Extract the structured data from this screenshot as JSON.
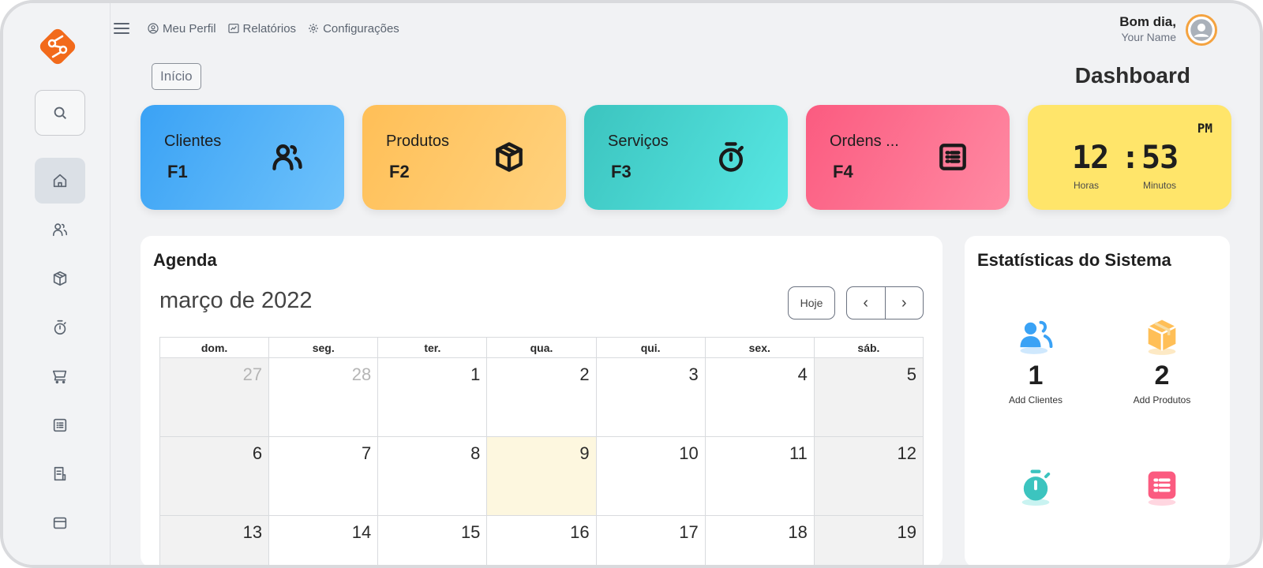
{
  "topbar": {
    "links": [
      {
        "label": "Meu Perfil",
        "icon": "user-circle-icon"
      },
      {
        "label": "Relatórios",
        "icon": "chart-icon"
      },
      {
        "label": "Configurações",
        "icon": "gear-icon"
      }
    ],
    "greeting": "Bom dia,",
    "user_name": "Your Name"
  },
  "breadcrumb": "Início",
  "page_title": "Dashboard",
  "sidebar": {
    "items": [
      "search-icon",
      "home-icon",
      "users-icon",
      "box-icon",
      "stopwatch-icon",
      "cart-icon",
      "list-icon",
      "receipt-icon",
      "card-icon"
    ]
  },
  "cards": [
    {
      "label": "Clientes",
      "key": "F1",
      "icon": "users-icon",
      "color": "#3aa2f5"
    },
    {
      "label": "Produtos",
      "key": "F2",
      "icon": "box-icon",
      "color": "#ffbf57"
    },
    {
      "label": "Serviços",
      "key": "F3",
      "icon": "stopwatch-icon",
      "color": "#3cc4bf"
    },
    {
      "label": "Ordens ...",
      "key": "F4",
      "icon": "list-icon",
      "color": "#fb5b80"
    }
  ],
  "clock": {
    "period": "PM",
    "hours": "12",
    "minutes": "53",
    "hours_label": "Horas",
    "minutes_label": "Minutos",
    "color": "#ffe56a"
  },
  "agenda": {
    "title": "Agenda",
    "month": "março de 2022",
    "today_button": "Hoje",
    "prev": "‹",
    "next": "›",
    "weekdays": [
      "dom.",
      "seg.",
      "ter.",
      "qua.",
      "qui.",
      "sex.",
      "sáb."
    ],
    "weeks": [
      [
        "27",
        "28",
        "1",
        "2",
        "3",
        "4",
        "5"
      ],
      [
        "6",
        "7",
        "8",
        "9",
        "10",
        "11",
        "12"
      ],
      [
        "13",
        "14",
        "15",
        "16",
        "17",
        "18",
        "19"
      ]
    ],
    "today": "9"
  },
  "stats": {
    "title": "Estatísticas do Sistema",
    "items": [
      {
        "value": "1",
        "label": "Add Clientes",
        "icon": "users-icon",
        "color": "#3aa2f5"
      },
      {
        "value": "2",
        "label": "Add Produtos",
        "icon": "box-icon",
        "color": "#ffbf57"
      },
      {
        "value": "",
        "label": "",
        "icon": "stopwatch-icon",
        "color": "#3cc4bf"
      },
      {
        "value": "",
        "label": "",
        "icon": "list-icon",
        "color": "#fb5b80"
      }
    ]
  }
}
